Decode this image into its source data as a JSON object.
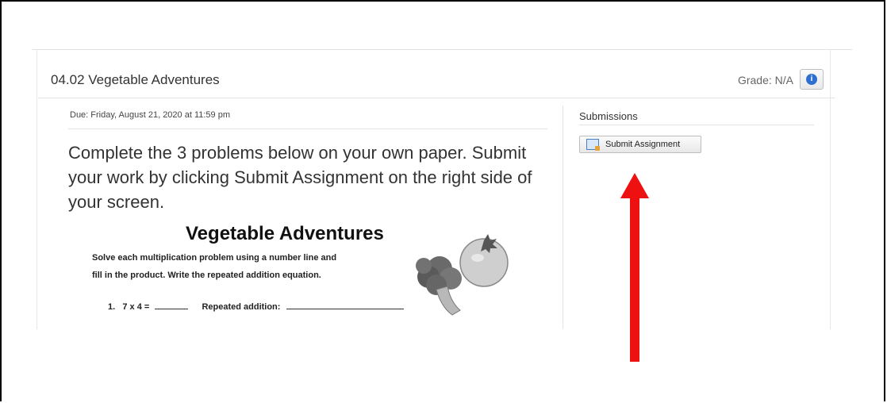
{
  "assignment": {
    "title": "04.02 Vegetable Adventures",
    "grade_label": "Grade:",
    "grade_value": "N/A",
    "info_icon": "info-icon",
    "due_text": "Due: Friday, August 21, 2020 at 11:59 pm",
    "instructions": "Complete the 3 problems below on your own paper. Submit your work by clicking Submit Assignment on the right side of your screen."
  },
  "worksheet": {
    "title": "Vegetable Adventures",
    "line1": "Solve each multiplication problem using a number line and",
    "line2": "fill in the product. Write the repeated addition equation.",
    "problem_number": "1.",
    "problem_expr": "7 x 4 =",
    "repeated_label": "Repeated addition:"
  },
  "submissions": {
    "heading": "Submissions",
    "submit_label": "Submit Assignment",
    "submit_icon": "assignment-doc-icon"
  },
  "colors": {
    "arrow": "#ee1111",
    "info_blue": "#2f6fcf"
  }
}
